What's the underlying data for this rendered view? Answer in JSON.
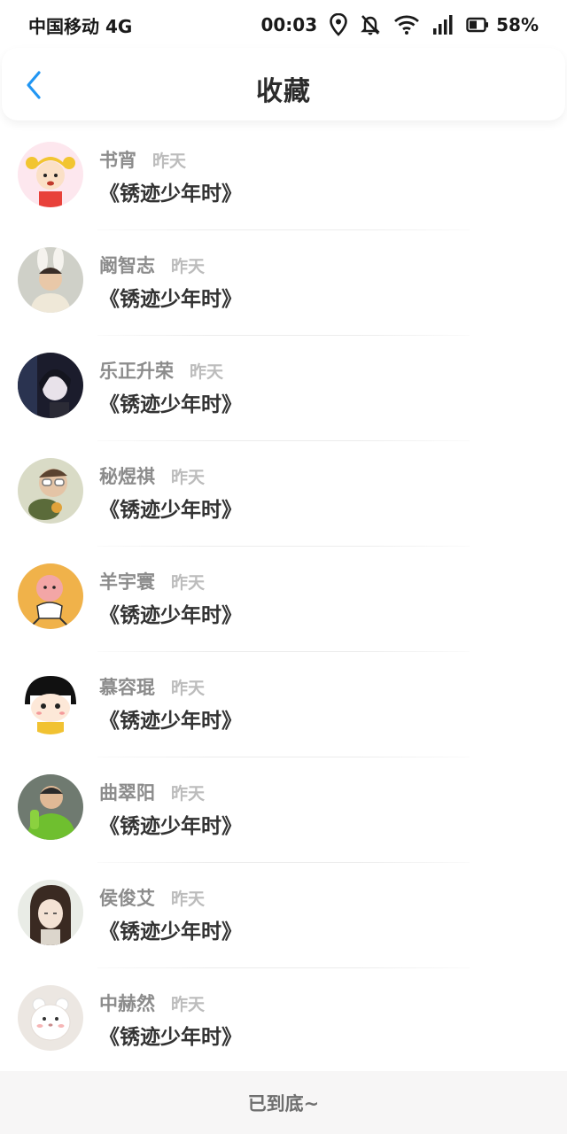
{
  "status_bar": {
    "carrier": "中国移动 4G",
    "time": "00:03",
    "battery": "58%",
    "icons": [
      "location-icon",
      "bell-muted-icon",
      "wifi-icon",
      "signal-icon",
      "battery-icon"
    ]
  },
  "header": {
    "back_icon": "chevron-left-icon",
    "title": "收藏",
    "accent": "#2196f3"
  },
  "favorites": [
    {
      "name": "书宵",
      "time": "昨天",
      "work": "《锈迹少年时》",
      "avatar": "cartoon-girl-pigtails"
    },
    {
      "name": "阚智志",
      "time": "昨天",
      "work": "《锈迹少年时》",
      "avatar": "person-bunny-ears"
    },
    {
      "name": "乐正升荣",
      "time": "昨天",
      "work": "《锈迹少年时》",
      "avatar": "anime-dark-hair"
    },
    {
      "name": "秘煜祺",
      "time": "昨天",
      "work": "《锈迹少年时》",
      "avatar": "person-glasses"
    },
    {
      "name": "羊宇寰",
      "time": "昨天",
      "work": "《锈迹少年时》",
      "avatar": "cartoon-pink-kid-yellow-bg"
    },
    {
      "name": "慕容琨",
      "time": "昨天",
      "work": "《锈迹少年时》",
      "avatar": "cartoon-bob-hair-girl"
    },
    {
      "name": "曲翠阳",
      "time": "昨天",
      "work": "《锈迹少年时》",
      "avatar": "person-green-shirt"
    },
    {
      "name": "侯俊艾",
      "time": "昨天",
      "work": "《锈迹少年时》",
      "avatar": "anime-long-hair"
    },
    {
      "name": "中赫然",
      "time": "昨天",
      "work": "《锈迹少年时》",
      "avatar": "cartoon-white-bear"
    }
  ],
  "footer": {
    "text": "已到底~"
  }
}
